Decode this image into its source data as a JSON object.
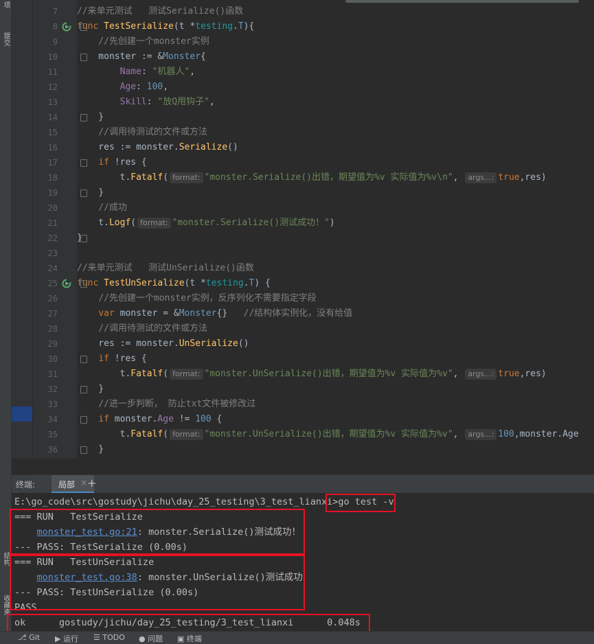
{
  "side_tabs": {
    "top": "项",
    "commit": "提交",
    "structure": "结构",
    "favorites": "收藏夹"
  },
  "code_lines": [
    {
      "n": "7",
      "segs": [
        [
          "cm",
          "//来单元测试   测试Serialize()函数"
        ]
      ]
    },
    {
      "n": "8",
      "segs": [
        [
          "kw",
          "func "
        ],
        [
          "fn",
          "TestSerialize"
        ],
        [
          "pl",
          "(t *"
        ],
        [
          "ptype",
          "testing"
        ],
        [
          "pl",
          "."
        ],
        [
          "ty",
          "T"
        ],
        [
          "pl",
          "){"
        ]
      ]
    },
    {
      "n": "9",
      "segs": [
        [
          "pl",
          "    "
        ],
        [
          "cm",
          "//先创建一个monster实例"
        ]
      ]
    },
    {
      "n": "10",
      "segs": [
        [
          "pl",
          "    monster := &"
        ],
        [
          "ty",
          "Monster"
        ],
        [
          "pl",
          "{"
        ]
      ]
    },
    {
      "n": "11",
      "segs": [
        [
          "pl",
          "        "
        ],
        [
          "fld",
          "Name"
        ],
        [
          "pl",
          ": "
        ],
        [
          "str",
          "\"机器人\""
        ],
        [
          "pl",
          ","
        ]
      ]
    },
    {
      "n": "12",
      "segs": [
        [
          "pl",
          "        "
        ],
        [
          "fld",
          "Age"
        ],
        [
          "pl",
          ": "
        ],
        [
          "num",
          "100"
        ],
        [
          "pl",
          ","
        ]
      ]
    },
    {
      "n": "13",
      "segs": [
        [
          "pl",
          "        "
        ],
        [
          "fld",
          "Skill"
        ],
        [
          "pl",
          ": "
        ],
        [
          "str",
          "\"放Q甩钩子\""
        ],
        [
          "pl",
          ","
        ]
      ]
    },
    {
      "n": "14",
      "segs": [
        [
          "pl",
          "    }"
        ]
      ]
    },
    {
      "n": "15",
      "segs": [
        [
          "pl",
          "    "
        ],
        [
          "cm",
          "//调用待测试的文件或方法"
        ]
      ]
    },
    {
      "n": "16",
      "segs": [
        [
          "pl",
          "    res := monster."
        ],
        [
          "fn",
          "Serialize"
        ],
        [
          "pl",
          "()"
        ]
      ]
    },
    {
      "n": "17",
      "segs": [
        [
          "pl",
          "    "
        ],
        [
          "kw",
          "if "
        ],
        [
          "pl",
          "!res {"
        ]
      ]
    },
    {
      "n": "18",
      "segs": [
        [
          "pl",
          "        t."
        ],
        [
          "fn",
          "Fatalf"
        ],
        [
          "pl",
          "("
        ],
        [
          "hint",
          "format:"
        ],
        [
          "str",
          "\"monster.Serialize()出错，期望值为%v 实际值为%v\\n\""
        ],
        [
          "pl",
          ", "
        ],
        [
          "hint",
          "args...:"
        ],
        [
          "kw",
          "true"
        ],
        [
          "pl",
          ",res)"
        ]
      ]
    },
    {
      "n": "19",
      "segs": [
        [
          "pl",
          "    }"
        ]
      ]
    },
    {
      "n": "20",
      "segs": [
        [
          "pl",
          "    "
        ],
        [
          "cm",
          "//成功"
        ]
      ]
    },
    {
      "n": "21",
      "segs": [
        [
          "pl",
          "    t."
        ],
        [
          "fn",
          "Logf"
        ],
        [
          "pl",
          "("
        ],
        [
          "hint",
          "format:"
        ],
        [
          "str",
          "\"monster.Serialize()测试成功！\""
        ],
        [
          "pl",
          ")"
        ]
      ]
    },
    {
      "n": "22",
      "segs": [
        [
          "pl",
          "}"
        ]
      ]
    },
    {
      "n": "23",
      "segs": []
    },
    {
      "n": "24",
      "segs": [
        [
          "cm",
          "//来单元测试   测试UnSerialize()函数"
        ]
      ]
    },
    {
      "n": "25",
      "segs": [
        [
          "kw",
          "func "
        ],
        [
          "fn",
          "TestUnSerialize"
        ],
        [
          "pl",
          "(t *"
        ],
        [
          "ptype",
          "testing"
        ],
        [
          "pl",
          "."
        ],
        [
          "ty",
          "T"
        ],
        [
          "pl",
          ") {"
        ]
      ]
    },
    {
      "n": "26",
      "segs": [
        [
          "pl",
          "    "
        ],
        [
          "cm",
          "//先创建一个monster实例，反序列化不需要指定字段"
        ]
      ]
    },
    {
      "n": "27",
      "segs": [
        [
          "pl",
          "    "
        ],
        [
          "kw",
          "var "
        ],
        [
          "pl",
          "monster = &"
        ],
        [
          "ty",
          "Monster"
        ],
        [
          "pl",
          "{}   "
        ],
        [
          "cm",
          "//结构体实例化，没有给值"
        ]
      ]
    },
    {
      "n": "28",
      "segs": [
        [
          "pl",
          "    "
        ],
        [
          "cm",
          "//调用待测试的文件或方法"
        ]
      ]
    },
    {
      "n": "29",
      "segs": [
        [
          "pl",
          "    res := monster."
        ],
        [
          "fn",
          "UnSerialize"
        ],
        [
          "pl",
          "()"
        ]
      ]
    },
    {
      "n": "30",
      "segs": [
        [
          "pl",
          "    "
        ],
        [
          "kw",
          "if "
        ],
        [
          "pl",
          "!res {"
        ]
      ]
    },
    {
      "n": "31",
      "segs": [
        [
          "pl",
          "        t."
        ],
        [
          "fn",
          "Fatalf"
        ],
        [
          "pl",
          "("
        ],
        [
          "hint",
          "format:"
        ],
        [
          "str",
          "\"monster.UnSerialize()出错，期望值为%v 实际值为%v\""
        ],
        [
          "pl",
          ", "
        ],
        [
          "hint",
          "args...:"
        ],
        [
          "kw",
          "true"
        ],
        [
          "pl",
          ",res)"
        ]
      ]
    },
    {
      "n": "32",
      "segs": [
        [
          "pl",
          "    }"
        ]
      ]
    },
    {
      "n": "33",
      "segs": [
        [
          "pl",
          "    "
        ],
        [
          "cm",
          "//进一步判断， 防止txt文件被修改过"
        ]
      ]
    },
    {
      "n": "34",
      "segs": [
        [
          "pl",
          "    "
        ],
        [
          "kw",
          "if "
        ],
        [
          "pl",
          "monster."
        ],
        [
          "fld",
          "Age"
        ],
        [
          "pl",
          " != "
        ],
        [
          "num",
          "100"
        ],
        [
          "pl",
          " {"
        ]
      ]
    },
    {
      "n": "35",
      "segs": [
        [
          "pl",
          "        t."
        ],
        [
          "fn",
          "Fatalf"
        ],
        [
          "pl",
          "("
        ],
        [
          "hint",
          "format:"
        ],
        [
          "str",
          "\"monster.UnSerialize()出错，期望值为%v 实际值为%v\""
        ],
        [
          "pl",
          ", "
        ],
        [
          "hint",
          "args...:"
        ],
        [
          "num",
          "100"
        ],
        [
          "pl",
          ",monster.Age"
        ]
      ]
    },
    {
      "n": "36",
      "segs": [
        [
          "pl",
          "    }"
        ]
      ]
    }
  ],
  "terminal": {
    "label": "终端:",
    "tab_label": "局部",
    "tab_close": "×",
    "add": "+",
    "prompt": "E:\\go_code\\src\\gostudy\\jichu\\day_25_testing\\3_test_lianxi>",
    "command": "go test -v",
    "lines": {
      "run1": "=== RUN   TestSerialize",
      "log1_link": "monster_test.go:21",
      "log1_msg": ": monster.Serialize()测试成功！",
      "pass1": "--- PASS: TestSerialize (0.00s)",
      "run2": "=== RUN   TestUnSerialize",
      "log2_link": "monster_test.go:38",
      "log2_msg": ": monster.UnSerialize()测试成功",
      "pass2": "--- PASS: TestUnSerialize (0.00s)",
      "pass": "PASS",
      "ok_line": "ok      gostudy/jichu/day_25_testing/3_test_lianxi      0.048s"
    }
  },
  "statusbar": {
    "git": "Git",
    "run": "运行",
    "todo": "TODO",
    "problems": "问题",
    "terminal": "终端"
  },
  "colors": {
    "highlight": "#e81123",
    "accent": "#4a88c7"
  }
}
